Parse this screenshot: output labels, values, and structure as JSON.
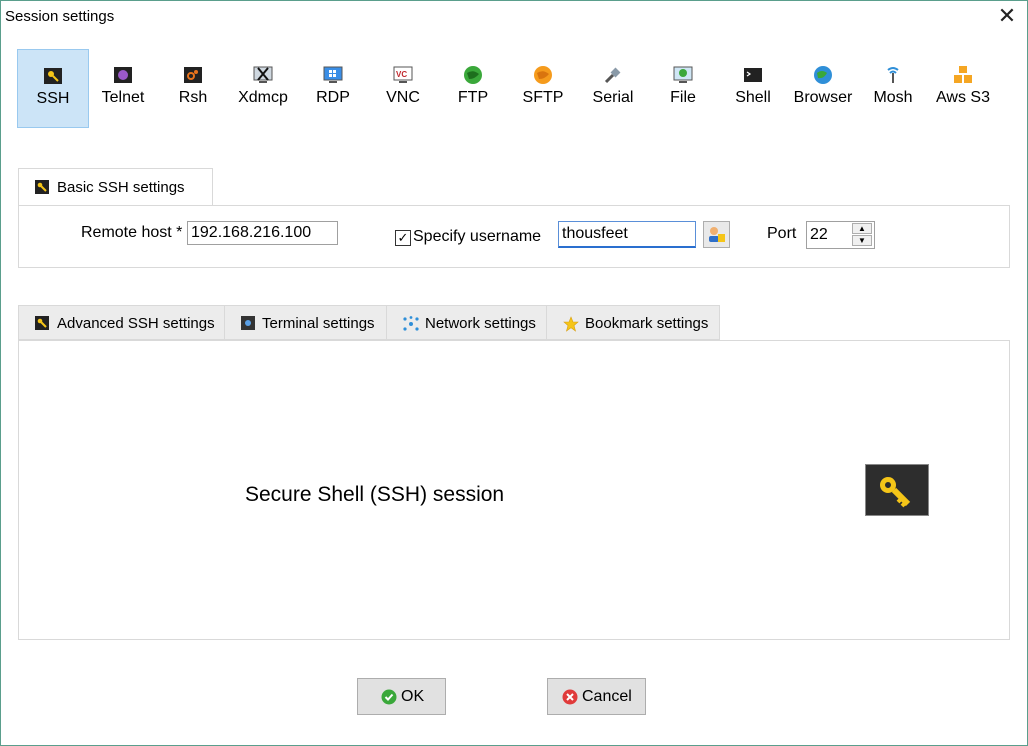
{
  "window": {
    "title": "Session settings",
    "close_glyph": "✕"
  },
  "session_types": [
    {
      "label": "SSH",
      "icon": "ssh-key-icon",
      "selected": true
    },
    {
      "label": "Telnet",
      "icon": "telnet-icon",
      "selected": false
    },
    {
      "label": "Rsh",
      "icon": "rsh-icon",
      "selected": false
    },
    {
      "label": "Xdmcp",
      "icon": "xdmcp-icon",
      "selected": false
    },
    {
      "label": "RDP",
      "icon": "rdp-icon",
      "selected": false
    },
    {
      "label": "VNC",
      "icon": "vnc-icon",
      "selected": false
    },
    {
      "label": "FTP",
      "icon": "ftp-globe-icon",
      "selected": false
    },
    {
      "label": "SFTP",
      "icon": "sftp-globe-icon",
      "selected": false
    },
    {
      "label": "Serial",
      "icon": "serial-plug-icon",
      "selected": false
    },
    {
      "label": "File",
      "icon": "file-monitor-icon",
      "selected": false
    },
    {
      "label": "Shell",
      "icon": "shell-terminal-icon",
      "selected": false
    },
    {
      "label": "Browser",
      "icon": "browser-globe-icon",
      "selected": false
    },
    {
      "label": "Mosh",
      "icon": "mosh-antenna-icon",
      "selected": false
    },
    {
      "label": "Aws S3",
      "icon": "aws-cubes-icon",
      "selected": false
    }
  ],
  "basic": {
    "tab_label": "Basic SSH settings",
    "remote_host_label": "Remote host *",
    "remote_host_value": "192.168.216.100",
    "specify_username_label": "Specify username",
    "specify_username_checked": true,
    "username_value": "thousfeet",
    "port_label": "Port",
    "port_value": "22"
  },
  "subtabs": [
    {
      "label": "Advanced SSH settings",
      "icon": "ssh-key-icon"
    },
    {
      "label": "Terminal settings",
      "icon": "terminal-icon"
    },
    {
      "label": "Network settings",
      "icon": "network-icon"
    },
    {
      "label": "Bookmark settings",
      "icon": "star-icon"
    }
  ],
  "panel": {
    "heading": "Secure Shell (SSH) session"
  },
  "buttons": {
    "ok": "OK",
    "cancel": "Cancel"
  },
  "colors": {
    "selected_bg": "#cce4f7",
    "key_yellow": "#f5c518",
    "ok_green": "#3aa83a",
    "cancel_red": "#e03a3a"
  }
}
